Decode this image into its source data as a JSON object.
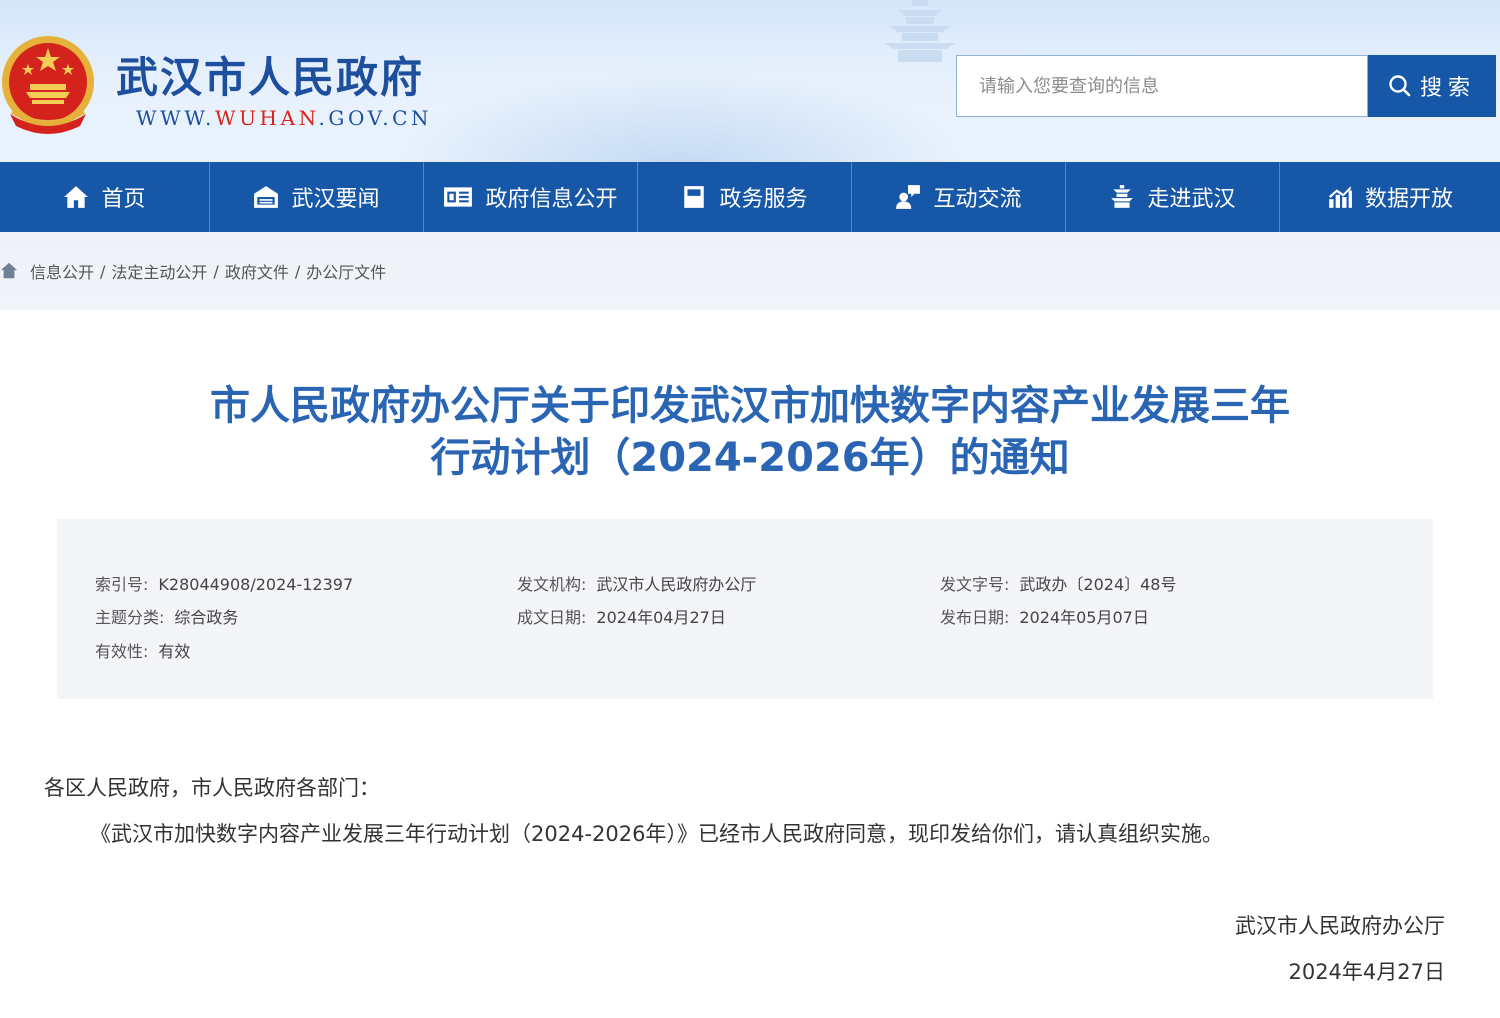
{
  "header": {
    "site_title": "武汉市人民政府",
    "domain_prefix": "WWW.",
    "domain_highlight": "WUHAN",
    "domain_suffix": ".GOV.CN",
    "search_placeholder": "请输入您要查询的信息",
    "search_button_label": "搜索",
    "brand_blue": "#1d4f9e",
    "brand_red": "#d9241b"
  },
  "nav": {
    "color": "#1757a8",
    "items": [
      {
        "label": "首页",
        "icon": "home-icon"
      },
      {
        "label": "武汉要闻",
        "icon": "news-icon"
      },
      {
        "label": "政府信息公开",
        "icon": "info-open-icon"
      },
      {
        "label": "政务服务",
        "icon": "service-icon"
      },
      {
        "label": "互动交流",
        "icon": "interaction-icon"
      },
      {
        "label": "走进武汉",
        "icon": "pavilion-icon"
      },
      {
        "label": "数据开放",
        "icon": "data-chart-icon"
      }
    ]
  },
  "breadcrumb": [
    "信息公开",
    "法定主动公开",
    "政府文件",
    "办公厅文件"
  ],
  "article": {
    "title_line1": "市人民政府办公厅关于印发武汉市加快数字内容产业发展三年",
    "title_line2": "行动计划（2024-2026年）的通知",
    "title_color": "#2a65b4",
    "meta": {
      "index_label": "索引号:",
      "index_value": "K28044908/2024-12397",
      "issuer_label": "发文机构:",
      "issuer_value": "武汉市人民政府办公厅",
      "doc_no_label": "发文字号:",
      "doc_no_value": "武政办〔2024〕48号",
      "topic_label": "主题分类:",
      "topic_value": "综合政务",
      "created_label": "成文日期:",
      "created_value": "2024年04月27日",
      "published_label": "发布日期:",
      "published_value": "2024年05月07日",
      "validity_label": "有效性:",
      "validity_value": "有效"
    },
    "salutation": "各区人民政府，市人民政府各部门：",
    "paragraph": "《武汉市加快数字内容产业发展三年行动计划（2024-2026年）》已经市人民政府同意，现印发给你们，请认真组织实施。",
    "signature": "武汉市人民政府办公厅",
    "date": "2024年4月27日"
  }
}
